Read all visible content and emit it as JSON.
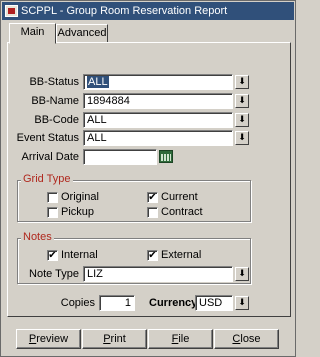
{
  "window": {
    "title": "SCPPL - Group Room Reservation Report"
  },
  "tabs": [
    {
      "label": "Main",
      "active": true
    },
    {
      "label": "Advanced",
      "active": false
    }
  ],
  "filters": {
    "bb_status": {
      "label": "BB-Status",
      "value": "ALL"
    },
    "bb_name": {
      "label": "BB-Name",
      "value": "1894884"
    },
    "bb_code": {
      "label": "BB-Code",
      "value": "ALL"
    },
    "event_status": {
      "label": "Event Status",
      "value": "ALL"
    },
    "arrival_date": {
      "label": "Arrival Date",
      "value": ""
    }
  },
  "grid_type": {
    "title": "Grid Type",
    "options": [
      {
        "label": "Original",
        "checked": false
      },
      {
        "label": "Current",
        "checked": true
      },
      {
        "label": "Pickup",
        "checked": false
      },
      {
        "label": "Contract",
        "checked": false
      }
    ]
  },
  "notes": {
    "title": "Notes",
    "internal": {
      "label": "Internal",
      "checked": true
    },
    "external": {
      "label": "External",
      "checked": true
    },
    "note_type": {
      "label": "Note Type",
      "value": "LIZ"
    }
  },
  "copies": {
    "label": "Copies",
    "value": "1"
  },
  "currency": {
    "label": "Currency",
    "value": "USD"
  },
  "buttons": {
    "preview": {
      "prefix": "P",
      "rest": "review"
    },
    "print": {
      "prefix": "P",
      "rest": "rint"
    },
    "file": {
      "prefix": "F",
      "rest": "ile"
    },
    "close": {
      "prefix": "C",
      "rest": "lose"
    }
  },
  "icons": {
    "dropdown": "down-arrow-icon",
    "calendar": "calendar-icon",
    "check": "check-icon"
  },
  "colors": {
    "titlebar": "#30507a",
    "group_title": "#b0281e",
    "face": "#d4d0c8"
  }
}
